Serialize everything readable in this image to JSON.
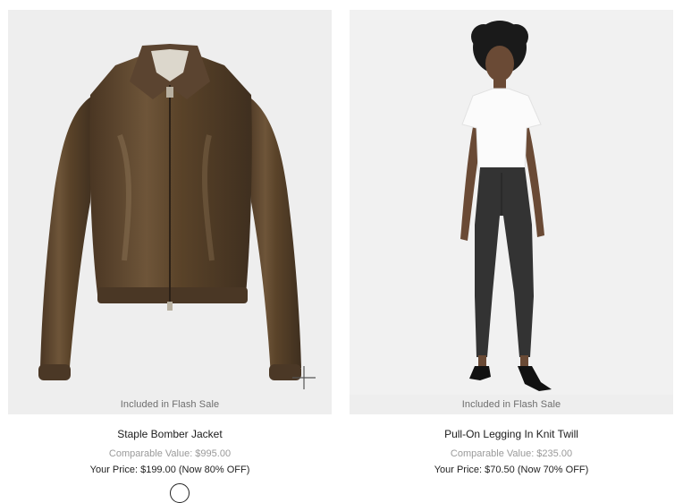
{
  "products": [
    {
      "badge": "Included in Flash Sale",
      "name": "Staple Bomber Jacket",
      "comparable": "Comparable Value: $995.00",
      "your_price": "Your Price: $199.00 (Now 80% OFF)",
      "image": "leather-bomber-jacket"
    },
    {
      "badge": "Included in Flash Sale",
      "name": "Pull-On Legging In Knit Twill",
      "comparable": "Comparable Value: $235.00",
      "your_price": "Your Price: $70.50 (Now 70% OFF)",
      "image": "model-in-leggings"
    }
  ],
  "colors": {
    "leather": "#5c4630",
    "card_bg": "#eeeeee",
    "legging": "#333333"
  }
}
